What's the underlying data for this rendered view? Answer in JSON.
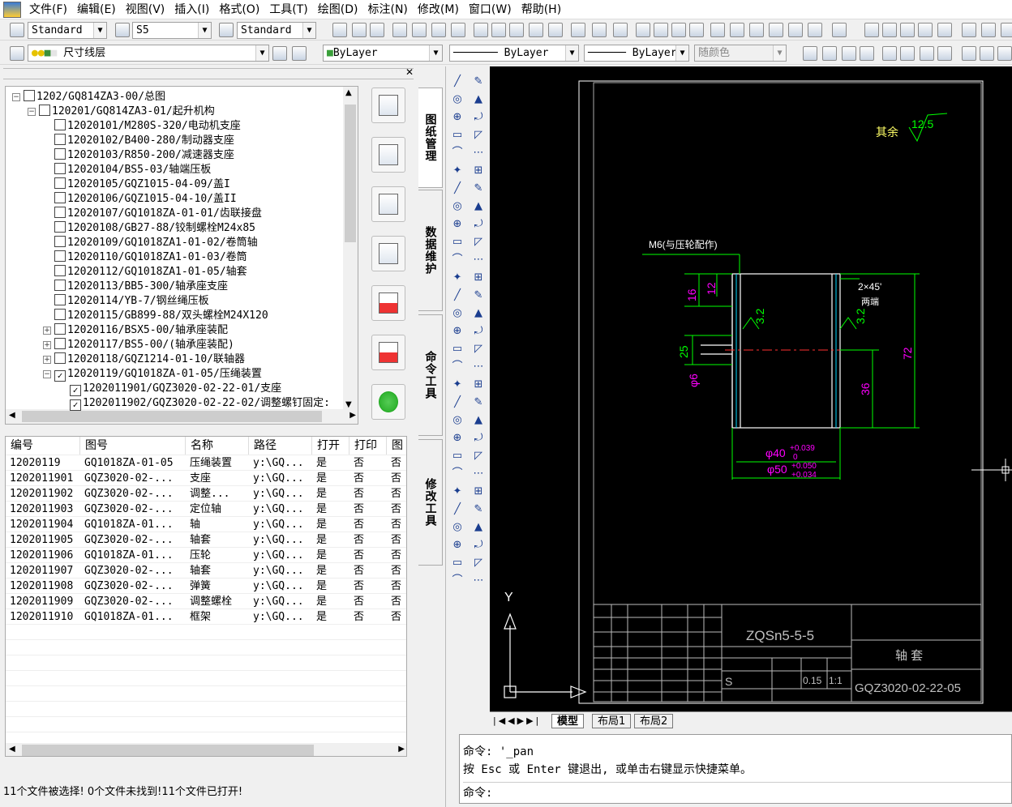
{
  "menu": [
    "文件(F)",
    "编辑(E)",
    "视图(V)",
    "插入(I)",
    "格式(O)",
    "工具(T)",
    "绘图(D)",
    "标注(N)",
    "修改(M)",
    "窗口(W)",
    "帮助(H)"
  ],
  "toolbar": {
    "text_style": "Standard",
    "dim_style": "S5",
    "table_style": "Standard",
    "layer": "尺寸线层",
    "color": "ByLayer",
    "linetype": "ByLayer",
    "lineweight": "ByLayer",
    "plotstyle": "随颜色"
  },
  "tree": {
    "nodes": [
      {
        "label": "1202/GQ814ZA3-00/总图",
        "level": 0,
        "checked": false,
        "expander": "−"
      },
      {
        "label": "120201/GQ814ZA3-01/起升机构",
        "level": 1,
        "checked": false,
        "expander": "−"
      },
      {
        "label": "12020101/M280S-320/电动机支座",
        "level": 2,
        "checked": false,
        "expander": ""
      },
      {
        "label": "12020102/B400-280/制动器支座",
        "level": 2,
        "checked": false,
        "expander": ""
      },
      {
        "label": "12020103/R850-200/减速器支座",
        "level": 2,
        "checked": false,
        "expander": ""
      },
      {
        "label": "12020104/BS5-03/轴端压板",
        "level": 2,
        "checked": false,
        "expander": ""
      },
      {
        "label": "12020105/GQZ1015-04-09/盖I",
        "level": 2,
        "checked": false,
        "expander": ""
      },
      {
        "label": "12020106/GQZ1015-04-10/盖II",
        "level": 2,
        "checked": false,
        "expander": ""
      },
      {
        "label": "12020107/GQ1018ZA-01-01/齿联接盘",
        "level": 2,
        "checked": false,
        "expander": ""
      },
      {
        "label": "12020108/GB27-88/铰制螺栓M24x85",
        "level": 2,
        "checked": false,
        "expander": ""
      },
      {
        "label": "12020109/GQ1018ZA1-01-02/卷筒轴",
        "level": 2,
        "checked": false,
        "expander": ""
      },
      {
        "label": "12020110/GQ1018ZA1-01-03/卷筒",
        "level": 2,
        "checked": false,
        "expander": ""
      },
      {
        "label": "12020112/GQ1018ZA1-01-05/轴套",
        "level": 2,
        "checked": false,
        "expander": ""
      },
      {
        "label": "12020113/BB5-300/轴承座支座",
        "level": 2,
        "checked": false,
        "expander": ""
      },
      {
        "label": "12020114/YB-7/钢丝绳压板",
        "level": 2,
        "checked": false,
        "expander": ""
      },
      {
        "label": "12020115/GB899-88/双头螺栓M24X120",
        "level": 2,
        "checked": false,
        "expander": ""
      },
      {
        "label": "12020116/BSX5-00/轴承座装配",
        "level": 2,
        "checked": false,
        "expander": "+"
      },
      {
        "label": "12020117/BS5-00/(轴承座装配)",
        "level": 2,
        "checked": false,
        "expander": "+"
      },
      {
        "label": "12020118/GQZ1214-01-10/联轴器",
        "level": 2,
        "checked": false,
        "expander": "+"
      },
      {
        "label": "12020119/GQ1018ZA-01-05/压绳装置",
        "level": 2,
        "checked": true,
        "expander": "−"
      },
      {
        "label": "1202011901/GQZ3020-02-22-01/支座",
        "level": 3,
        "checked": true,
        "expander": ""
      },
      {
        "label": "1202011902/GQZ3020-02-22-02/调整螺钉固定:",
        "level": 3,
        "checked": true,
        "expander": ""
      }
    ]
  },
  "side_tabs": [
    "图纸管理",
    "数据维护",
    "命令工具",
    "修改工具"
  ],
  "grid": {
    "columns": [
      "编号",
      "图号",
      "名称",
      "路径",
      "打开",
      "打印",
      "图"
    ],
    "rows": [
      [
        "12020119",
        "GQ1018ZA-01-05",
        "压绳装置",
        "y:\\GQ...",
        "是",
        "否",
        "否"
      ],
      [
        "1202011901",
        "GQZ3020-02-...",
        "支座",
        "y:\\GQ...",
        "是",
        "否",
        "否"
      ],
      [
        "1202011902",
        "GQZ3020-02-...",
        "调整...",
        "y:\\GQ...",
        "是",
        "否",
        "否"
      ],
      [
        "1202011903",
        "GQZ3020-02-...",
        "定位轴",
        "y:\\GQ...",
        "是",
        "否",
        "否"
      ],
      [
        "1202011904",
        "GQ1018ZA-01...",
        "轴",
        "y:\\GQ...",
        "是",
        "否",
        "否"
      ],
      [
        "1202011905",
        "GQZ3020-02-...",
        "轴套",
        "y:\\GQ...",
        "是",
        "否",
        "否"
      ],
      [
        "1202011906",
        "GQ1018ZA-01...",
        "压轮",
        "y:\\GQ...",
        "是",
        "否",
        "否"
      ],
      [
        "1202011907",
        "GQZ3020-02-...",
        "轴套",
        "y:\\GQ...",
        "是",
        "否",
        "否"
      ],
      [
        "1202011908",
        "GQZ3020-02-...",
        "弹簧",
        "y:\\GQ...",
        "是",
        "否",
        "否"
      ],
      [
        "1202011909",
        "GQZ3020-02-...",
        "调整螺栓",
        "y:\\GQ...",
        "是",
        "否",
        "否"
      ],
      [
        "1202011910",
        "GQ1018ZA-01...",
        "框架",
        "y:\\GQ...",
        "是",
        "否",
        "否"
      ]
    ]
  },
  "status_text": "11个文件被选择! 0个文件未找到!11个文件已打开!",
  "drawing": {
    "roughness_label": "其余",
    "roughness_value": "12.5",
    "thread_note": "M6(与压轮配作)",
    "chamfer": "2×45'",
    "chamfer_note": "两端",
    "dim_16": "16",
    "dim_12": "12",
    "dim_25": "25",
    "dim_6": "φ6",
    "dim_36": "36",
    "dim_72": "72",
    "rough_32_left": "3.2",
    "rough_32_right": "3.2",
    "dia40": "φ40",
    "dia40_tol_up": "+0.039",
    "dia40_tol_low": "0",
    "dia50": "φ50",
    "dia50_tol_up": "+0.050",
    "dia50_tol_low": "+0.034",
    "material": "ZQSn5-5-5",
    "part_name": "轴  套",
    "drawing_no": "GQZ3020-02-22-05",
    "stage": "S",
    "weight": "0.15",
    "scale": "1:1",
    "axis_y": "Y"
  },
  "layout_tabs": [
    "模型",
    "布局1",
    "布局2"
  ],
  "command": {
    "line1": "命令: '_pan",
    "line2": "按 Esc 或 Enter 键退出, 或单击右键显示快捷菜单。",
    "prompt": "命令:"
  },
  "colors": {
    "canvas": "#000000",
    "geometry": "#ffffff",
    "dimension": "#00ff00",
    "dim_text": "#ff00ff",
    "title": "#c0c0c0"
  }
}
